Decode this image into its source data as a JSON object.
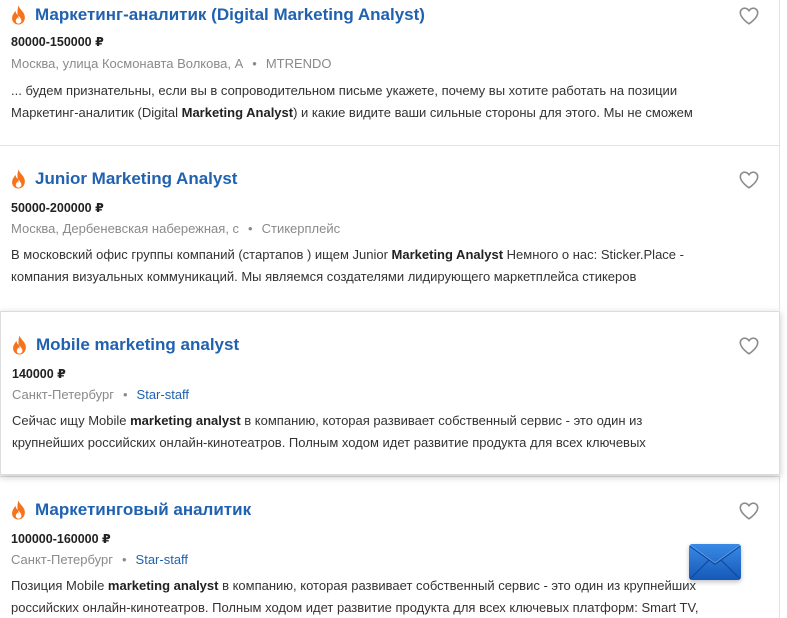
{
  "colors": {
    "title_link": "#2162b0",
    "fire_icon": "#f5731c",
    "meta_text": "#8a8a8a",
    "mail_button": "#1f6fd0"
  },
  "jobs": [
    {
      "title": "Маркетинг-аналитик (Digital Marketing Analyst)",
      "salary": "80000-150000 ₽",
      "location": "Москва, улица Космонавта Волкова, А",
      "company": "MTRENDO",
      "company_is_link": false,
      "snippet_line1": [
        {
          "t": "... будем признательны, если вы в сопроводительном письме укажете, почему вы хотите работать на позиции",
          "b": false
        }
      ],
      "snippet_line2": [
        {
          "t": "Маркетинг-аналитик (Digital ",
          "b": false
        },
        {
          "t": "Marketing Analyst",
          "b": true
        },
        {
          "t": ") и какие видите ваши сильные стороны для этого. Мы не сможем",
          "b": false
        }
      ]
    },
    {
      "title": "Junior Marketing Analyst",
      "salary": "50000-200000 ₽",
      "location": "Москва, Дербеневская набережная, с",
      "company": "Стикерплейс",
      "company_is_link": false,
      "snippet_line1": [
        {
          "t": "В московский офис группы компаний (стартапов ) ищем Junior ",
          "b": false
        },
        {
          "t": "Marketing Analyst",
          "b": true
        },
        {
          "t": " Немного о нас: Sticker.Place -",
          "b": false
        }
      ],
      "snippet_line2": [
        {
          "t": "компания визуальных коммуникаций. Мы являемся создателями лидирующего маркетплейса стикеров",
          "b": false
        }
      ]
    },
    {
      "title": "Mobile marketing analyst",
      "salary": "140000 ₽",
      "location": "Санкт-Петербург",
      "company": "Star-staff",
      "company_is_link": true,
      "snippet_line1": [
        {
          "t": "Сейчас ищу Mobile ",
          "b": false
        },
        {
          "t": "marketing analyst",
          "b": true
        },
        {
          "t": " в компанию, которая развивает собственный сервис - это один из",
          "b": false
        }
      ],
      "snippet_line2": [
        {
          "t": "крупнейших российских онлайн-кинотеатров. Полным ходом идет развитие продукта для всех ключевых",
          "b": false
        }
      ]
    },
    {
      "title": "Маркетинговый аналитик",
      "salary": "100000-160000 ₽",
      "location": "Санкт-Петербург",
      "company": "Star-staff",
      "company_is_link": true,
      "snippet_line1": [
        {
          "t": "Позиция Mobile ",
          "b": false
        },
        {
          "t": "marketing analyst",
          "b": true
        },
        {
          "t": " в компанию, которая развивает собственный сервис - это один из крупнейших",
          "b": false
        }
      ],
      "snippet_line2": [
        {
          "t": "российских онлайн-кинотеатров. Полным ходом идет развитие продукта для всех ключевых платформ: Smart TV,",
          "b": false
        }
      ]
    }
  ],
  "icons": {
    "hot": "fire-icon",
    "favorite": "heart-outline-icon",
    "mail": "envelope-icon"
  }
}
